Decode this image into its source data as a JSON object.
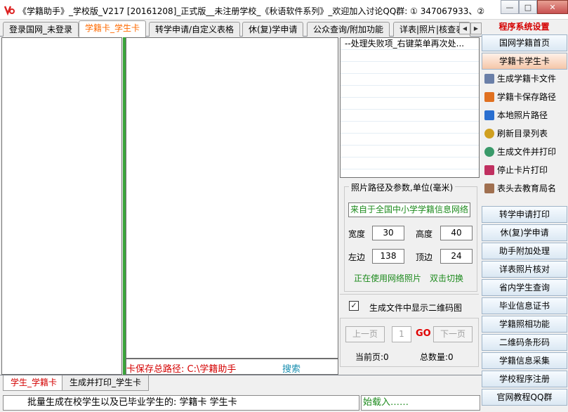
{
  "window": {
    "title": "《学籍助手》_学校版_V217 [20161208]_正式版__未注册学校_《秋语软件系列》_欢迎加入讨论QQ群: ① 347067933、②",
    "min_glyph": "—",
    "max_glyph": "□",
    "close_glyph": "✕"
  },
  "top_tabs": [
    "登录国网_未登录",
    "学籍卡_学生卡",
    "转学申请/自定义表格",
    "休(复)学申请",
    "公众查询/附加功能",
    "详表|照片|核查表"
  ],
  "tab_scroll": {
    "left": "◀",
    "right": "▶"
  },
  "center": {
    "path_label": "卡保存总路径:    C:\\学籍助手",
    "search_label": "搜索"
  },
  "result_list": {
    "rows": [
      "--处理失败项_右键菜单再次处...",
      "",
      "",
      "",
      "",
      "",
      "",
      "",
      "",
      "",
      ""
    ]
  },
  "photo_settings": {
    "legend": "照片路径及参数,单位(毫米)",
    "source": "来自于全国中小学学籍信息网络",
    "width_label": "宽度",
    "width_value": "30",
    "height_label": "高度",
    "height_value": "40",
    "left_label": "左边",
    "left_value": "138",
    "top_label": "顶边",
    "top_value": "24",
    "using_text": "正在使用网络照片",
    "switch_text": "双击切换"
  },
  "qr_option": {
    "checked_glyph": "✓",
    "label": "生成文件中显示二维码图"
  },
  "pager": {
    "prev": "上一页",
    "page": "1",
    "go": "GO",
    "next": "下一页",
    "current_label": "当前页:0",
    "total_label": "总数量:0"
  },
  "sidebar": {
    "header": "程序系统设置",
    "buttons_top": [
      "国网学籍首页",
      "学籍卡学生卡"
    ],
    "items": [
      {
        "label": "生成学籍卡文件",
        "icon": "tools-icon",
        "color": "#6a7fa8"
      },
      {
        "label": "学籍卡保存路径",
        "icon": "folder-paint-icon",
        "color": "#e07020"
      },
      {
        "label": "本地照片路径",
        "icon": "photo-icon",
        "color": "#2a6fd0"
      },
      {
        "label": "刷新目录列表",
        "icon": "refresh-icon",
        "color": "#d0a020"
      },
      {
        "label": "生成文件并打印",
        "icon": "globe-icon",
        "color": "#3a9a6a"
      },
      {
        "label": "停止卡片打印",
        "icon": "stop-print-icon",
        "color": "#c03060"
      },
      {
        "label": "表头去教育局名",
        "icon": "edit-icon",
        "color": "#a07050"
      }
    ],
    "buttons_bottom": [
      "转学申请打印",
      "休(复)学申请",
      "助手附加处理",
      "详表照片核对",
      "省内学生查询",
      "毕业信息证书",
      "学籍照相功能",
      "二维码条形码",
      "学籍信息采集",
      "学校程序注册",
      "官网教程QQ群"
    ]
  },
  "bottom_tabs": [
    "学生_学籍卡",
    "生成并打印_学生卡"
  ],
  "status": {
    "main": "批量生成在校学生以及已毕业学生的: 学籍卡 学生卡",
    "right": "始载入……"
  }
}
